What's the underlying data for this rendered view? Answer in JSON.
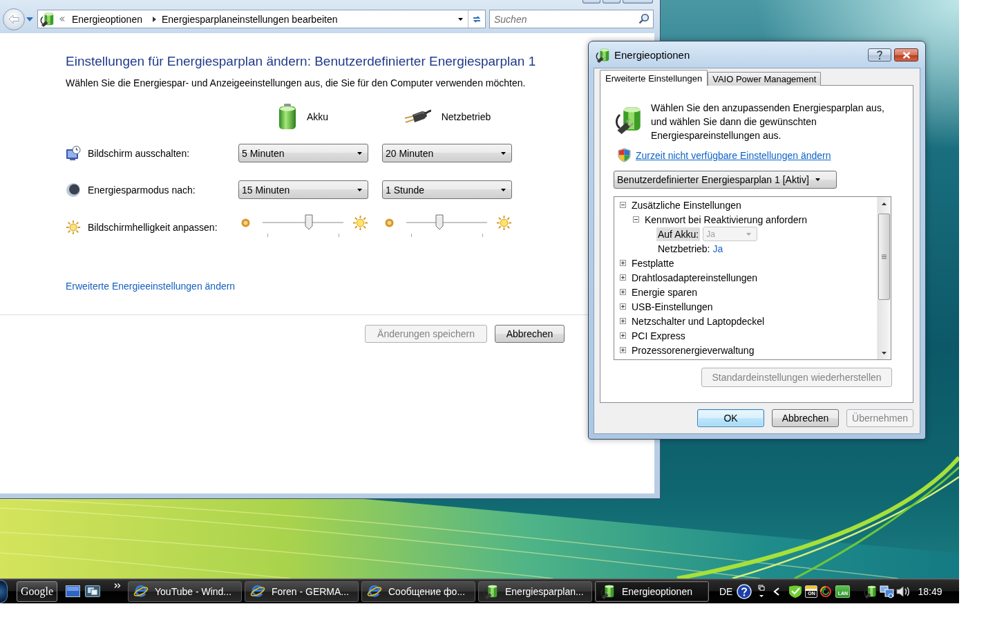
{
  "explorer_window": {
    "breadcrumbs": [
      "Energieoptionen",
      "Energiesparplaneinstellungen bearbeiten"
    ],
    "search": {
      "placeholder": "Suchen"
    },
    "heading": "Einstellungen für Energiesparplan ändern: Benutzerdefinierter Energiesparplan 1",
    "description": "Wählen Sie die Energiespar- und Anzeigeeinstellungen aus, die Sie für den Computer verwenden möchten.",
    "power_sources": [
      {
        "label": "Akku",
        "kind": "battery"
      },
      {
        "label": "Netzbetrieb",
        "kind": "plug"
      }
    ],
    "settings": [
      {
        "kind": "dropdown",
        "label": "Bildschirm ausschalten:",
        "values": [
          "5 Minuten",
          "20 Minuten"
        ]
      },
      {
        "kind": "dropdown",
        "label": "Energiesparmodus nach:",
        "values": [
          "15 Minuten",
          "1 Stunde"
        ]
      },
      {
        "kind": "slider",
        "label": "Bildschirmhelligkeit anpassen:",
        "sliders": [
          {
            "level": 0.58
          },
          {
            "level": 0.4
          }
        ]
      }
    ],
    "advanced_link": "Erweiterte Energieeinstellungen ändern",
    "buttons": [
      {
        "label": "Änderungen speichern",
        "disabled": true
      },
      {
        "label": "Abbrechen",
        "disabled": false
      }
    ]
  },
  "dialog": {
    "title": "Energieoptionen",
    "tabs": [
      {
        "label": "Erweiterte Einstellungen",
        "selected": true
      },
      {
        "label": "VAIO Power Management",
        "selected": false
      }
    ],
    "intro": "Wählen Sie den anzupassenden Energiesparplan aus, und wählen Sie dann die gewünschten Energiespareinstellungen aus.",
    "admin_link": "Zurzeit nicht verfügbare Einstellungen ändern",
    "plan_select": {
      "value": "Benutzerdefinierter Energiesparplan 1 [Aktiv]"
    },
    "tree": [
      {
        "label": "Zusätzliche Einstellungen",
        "expanded": true,
        "selected": false,
        "children": [
          {
            "label": "Kennwort bei Reaktivierung anfordern",
            "expanded": true,
            "selected": false,
            "children": [
              {
                "kind": "dropdown",
                "label": "Auf Akku:",
                "value": "Ja",
                "disabled": true,
                "selected": true
              },
              {
                "kind": "link",
                "label": "Netzbetrieb:",
                "value": "Ja",
                "selected": false
              }
            ]
          }
        ]
      },
      {
        "label": "Festplatte",
        "expanded": false,
        "selected": false
      },
      {
        "label": "Drahtlosadaptereinstellungen",
        "expanded": false,
        "selected": false
      },
      {
        "label": "Energie sparen",
        "expanded": false,
        "selected": false
      },
      {
        "label": "USB-Einstellungen",
        "expanded": false,
        "selected": false
      },
      {
        "label": "Netzschalter und Laptopdeckel",
        "expanded": false,
        "selected": false
      },
      {
        "label": "PCI Express",
        "expanded": false,
        "selected": false
      },
      {
        "label": "Prozessorenergieverwaltung",
        "expanded": false,
        "selected": false
      }
    ],
    "restore_button": {
      "label": "Standardeinstellungen wiederherstellen",
      "disabled": true
    },
    "buttons": [
      {
        "label": "OK",
        "disabled": false,
        "focused": true
      },
      {
        "label": "Abbrechen",
        "disabled": false,
        "focused": false
      },
      {
        "label": "Übernehmen",
        "disabled": true,
        "focused": false
      }
    ]
  },
  "taskbar": {
    "toolbar_button": "Google",
    "tasks": [
      {
        "label": "YouTube - Wind...",
        "kind": "browser",
        "selected": false
      },
      {
        "label": "Foren - GERMA...",
        "kind": "browser",
        "selected": false
      },
      {
        "label": "Сообщение фо...",
        "kind": "browser",
        "selected": false
      },
      {
        "label": "Energiesparplan...",
        "kind": "power",
        "selected": false
      },
      {
        "label": "Energieoptionen",
        "kind": "power",
        "selected": true
      }
    ],
    "language": "DE",
    "tray_badges": [
      "ON",
      "LAN"
    ],
    "clock": "18:49"
  }
}
